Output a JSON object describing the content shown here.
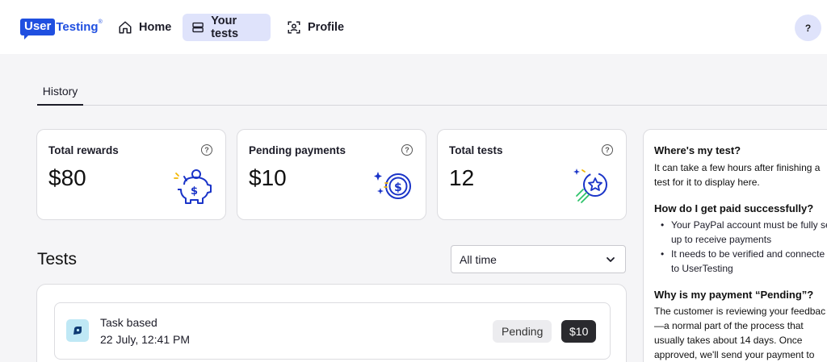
{
  "header": {
    "logo": {
      "part1": "User",
      "part2": "Testing",
      "tm": "®"
    },
    "nav": [
      {
        "label": "Home",
        "icon": "home-icon"
      },
      {
        "label": "Your tests",
        "icon": "tests-icon",
        "active": true
      },
      {
        "label": "Profile",
        "icon": "profile-icon"
      }
    ],
    "help_label": "?"
  },
  "tabs": [
    {
      "label": "History",
      "active": true
    }
  ],
  "stats": {
    "rewards": {
      "title": "Total rewards",
      "value": "$80",
      "icon": "piggy-bank-icon"
    },
    "pending": {
      "title": "Pending payments",
      "value": "$10",
      "icon": "coin-sparkle-icon"
    },
    "total": {
      "title": "Total tests",
      "value": "12",
      "icon": "star-badge-icon"
    },
    "help_glyph": "?"
  },
  "tests": {
    "heading": "Tests",
    "filter": {
      "selected": "All time"
    },
    "items": [
      {
        "name": "Task based",
        "date": "22 July, 12:41 PM",
        "status": "Pending",
        "amount": "$10",
        "icon": "task-icon"
      }
    ]
  },
  "faq": {
    "q1": "Where's my test?",
    "a1_l1": "It can take a few hours after finishing a",
    "a1_l2": "test for it to display here.",
    "q2": "How do I get paid successfully?",
    "b1_l1": "Your PayPal account must be fully se",
    "b1_l2": "up to receive payments",
    "b2_l1": "It needs to be verified and connecte",
    "b2_l2": "to UserTesting",
    "q3": "Why is my payment “Pending”?",
    "a3_l1": "The customer is reviewing your feedbac",
    "a3_l2": "—a normal part of the process that",
    "a3_l3": "usually takes about 14 days. Once",
    "a3_l4": "approved, we'll send your payment to"
  },
  "colors": {
    "brand": "#1f4fe0",
    "active_nav": "#dfe3fb",
    "icon_blue": "#1a34c8",
    "icon_yellow": "#f2b705",
    "icon_green": "#2fc36b"
  }
}
